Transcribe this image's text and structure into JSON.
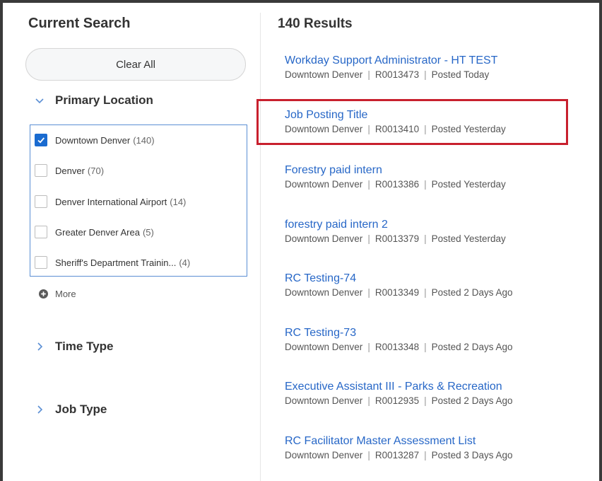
{
  "filters": {
    "heading": "Current Search",
    "clear_label": "Clear All",
    "primary_location": {
      "title": "Primary Location",
      "items": [
        {
          "label": "Downtown Denver",
          "count": "(140)",
          "checked": true
        },
        {
          "label": "Denver",
          "count": "(70)",
          "checked": false
        },
        {
          "label": "Denver International Airport",
          "count": "(14)",
          "checked": false
        },
        {
          "label": "Greater Denver Area",
          "count": "(5)",
          "checked": false
        },
        {
          "label": "Sheriff's Department Trainin...",
          "count": "(4)",
          "checked": false
        }
      ],
      "more_label": "More"
    },
    "time_type": {
      "title": "Time Type"
    },
    "job_type": {
      "title": "Job Type"
    }
  },
  "results": {
    "count_label": "140 Results",
    "items": [
      {
        "title": "Workday Support Administrator - HT TEST",
        "location": "Downtown Denver",
        "req_id": "R0013473",
        "posted": "Posted Today"
      },
      {
        "title": "Job Posting Title",
        "location": "Downtown Denver",
        "req_id": "R0013410",
        "posted": "Posted Yesterday"
      },
      {
        "title": "Forestry paid intern",
        "location": "Downtown Denver",
        "req_id": "R0013386",
        "posted": "Posted Yesterday"
      },
      {
        "title": "forestry paid intern 2",
        "location": "Downtown Denver",
        "req_id": "R0013379",
        "posted": "Posted Yesterday"
      },
      {
        "title": "RC Testing-74",
        "location": "Downtown Denver",
        "req_id": "R0013349",
        "posted": "Posted 2 Days Ago"
      },
      {
        "title": "RC Testing-73",
        "location": "Downtown Denver",
        "req_id": "R0013348",
        "posted": "Posted 2 Days Ago"
      },
      {
        "title": "Executive Assistant III - Parks & Recreation",
        "location": "Downtown Denver",
        "req_id": "R0012935",
        "posted": "Posted 2 Days Ago"
      },
      {
        "title": "RC Facilitator Master Assessment List",
        "location": "Downtown Denver",
        "req_id": "R0013287",
        "posted": "Posted 3 Days Ago"
      }
    ]
  },
  "meta_separator": "|",
  "colors": {
    "link": "#2767c7",
    "accent": "#1a6bd0",
    "highlight": "#c8202e"
  }
}
